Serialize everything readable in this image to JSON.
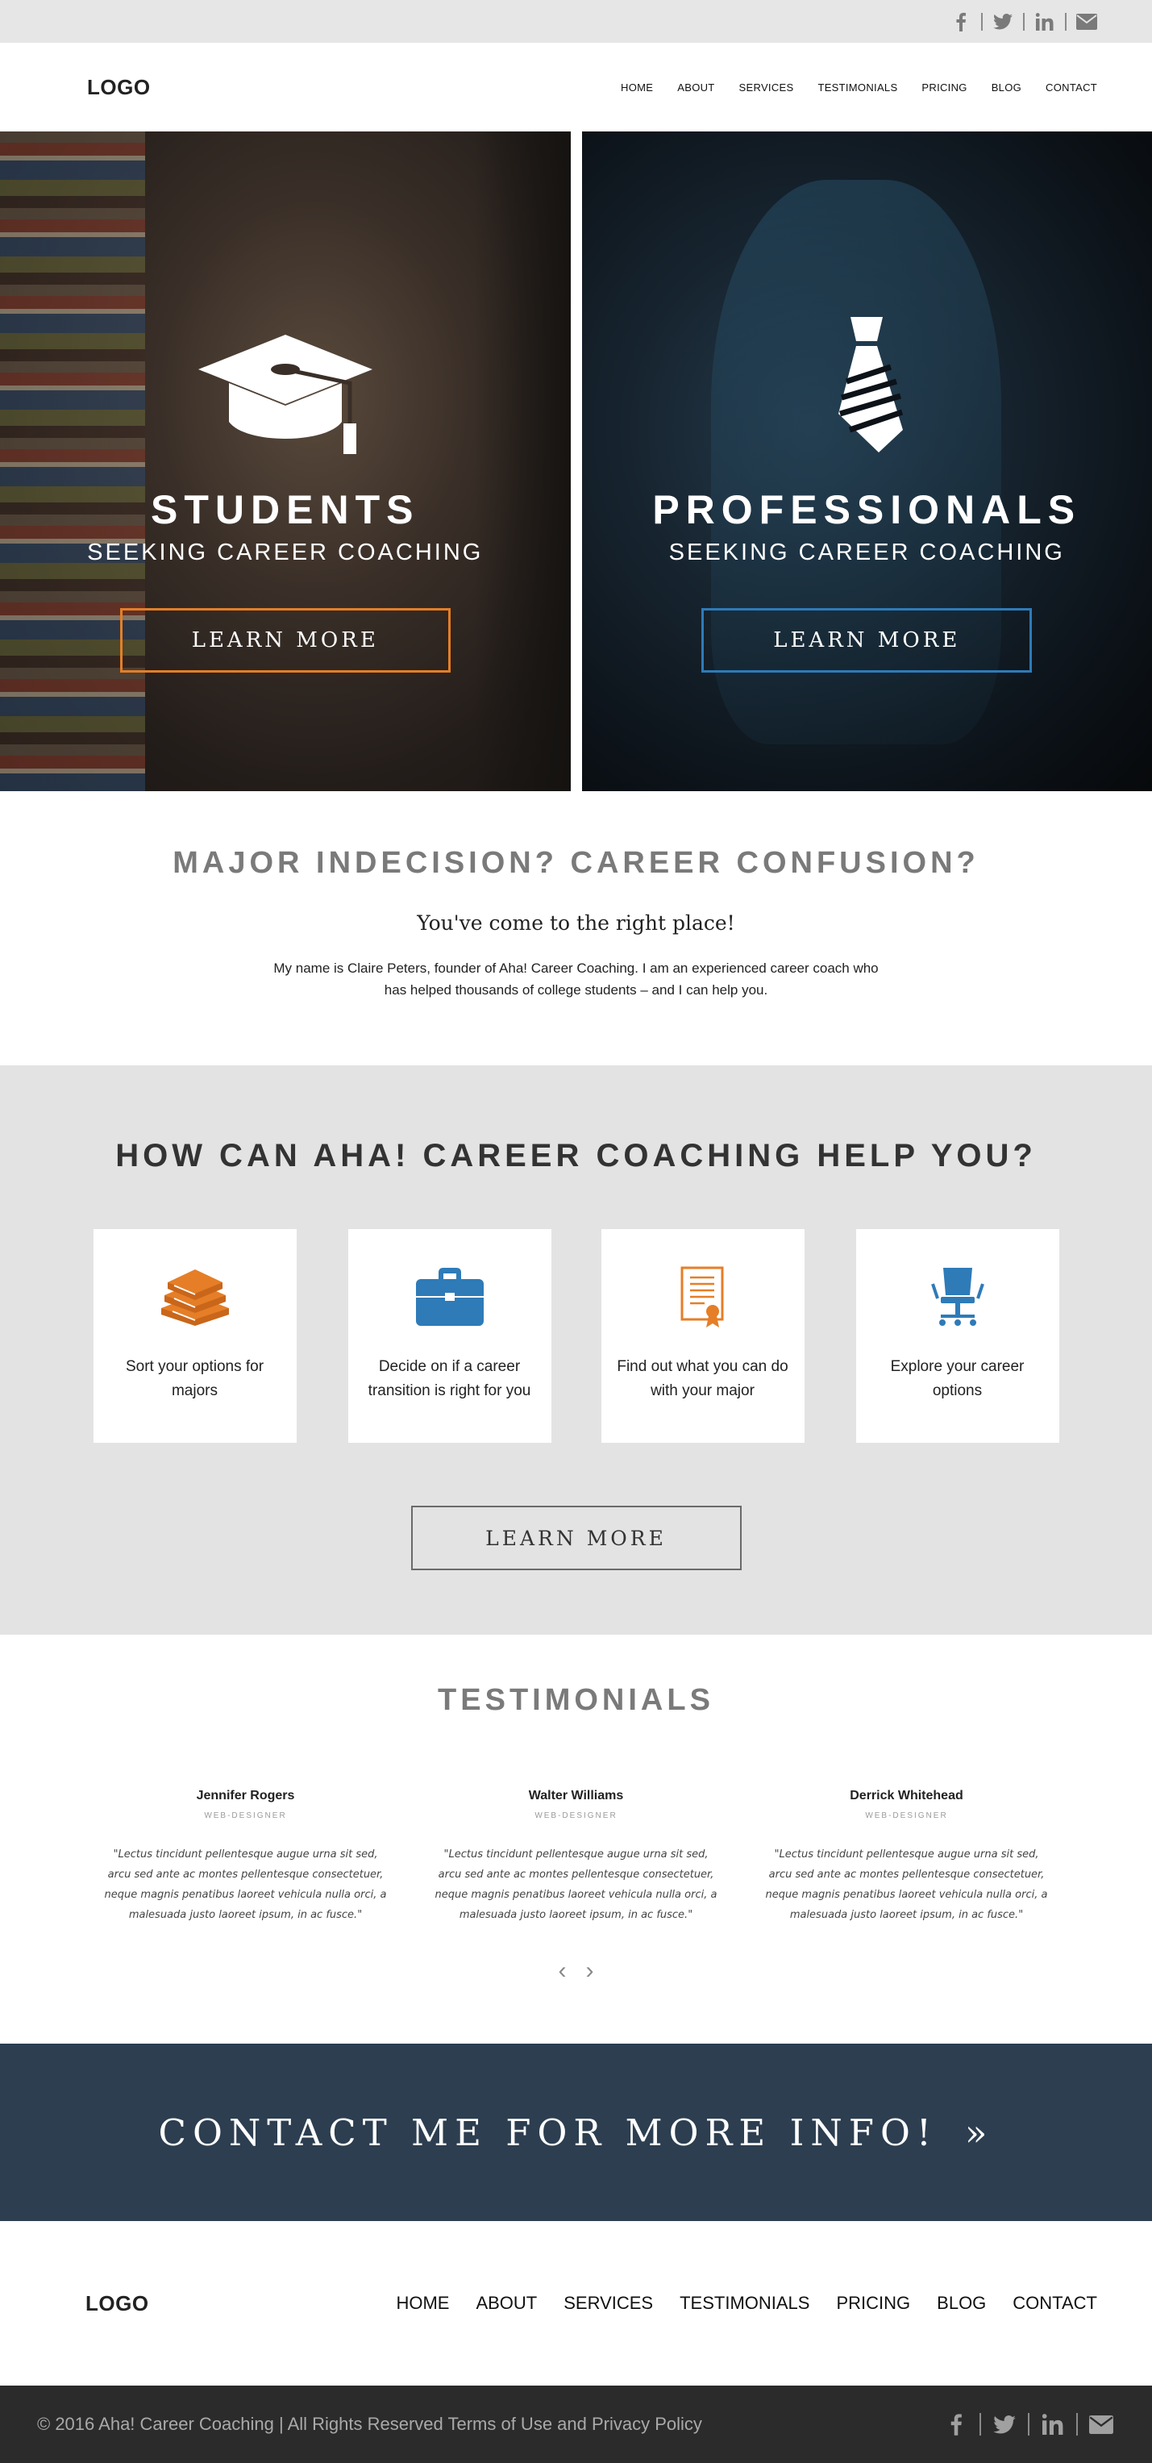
{
  "topbar": {
    "social": [
      {
        "name": "facebook-icon",
        "glyph": "f"
      },
      {
        "name": "twitter-icon",
        "glyph": "t"
      },
      {
        "name": "linkedin-icon",
        "glyph": "in"
      },
      {
        "name": "email-icon",
        "glyph": "mail"
      }
    ]
  },
  "header": {
    "logo": "LOGO",
    "nav": [
      "HOME",
      "ABOUT",
      "SERVICES",
      "TESTIMONIALS",
      "PRICING",
      "BLOG",
      "CONTACT"
    ]
  },
  "hero": {
    "students": {
      "icon": "graduation-cap-icon",
      "title": "STUDENTS",
      "subtitle": "SEEKING CAREER COACHING",
      "button": "LEARN MORE",
      "accent": "#e57e27"
    },
    "professionals": {
      "icon": "necktie-icon",
      "title": "PROFESSIONALS",
      "subtitle": "SEEKING CAREER COACHING",
      "button": "LEARN MORE",
      "accent": "#2e7bb8"
    }
  },
  "intro": {
    "heading": "MAJOR INDECISION? CAREER CONFUSION?",
    "lead": "You've come to the right place!",
    "body": "My name is Claire Peters, founder of Aha! Career Coaching. I am an experienced career coach who has helped thousands of college students – and I can help you."
  },
  "help": {
    "heading": "HOW CAN AHA! CAREER COACHING HELP YOU?",
    "cards": [
      {
        "icon": "books-icon",
        "color": "#e57e27",
        "text": "Sort your options for majors"
      },
      {
        "icon": "briefcase-icon",
        "color": "#2e7bb8",
        "text": "Decide on if a career transition is right for you"
      },
      {
        "icon": "certificate-icon",
        "color": "#e57e27",
        "text": "Find out what you can do with your major"
      },
      {
        "icon": "office-chair-icon",
        "color": "#2e7bb8",
        "text": "Explore your career options"
      }
    ],
    "button": "LEARN MORE"
  },
  "testimonials": {
    "heading": "TESTIMONIALS",
    "items": [
      {
        "name": "Jennifer Rogers",
        "role": "WEB-DESIGNER",
        "quote": "\"Lectus tincidunt pellentesque augue urna sit sed, arcu sed ante ac montes pellentesque consectetuer, neque magnis penatibus laoreet vehicula nulla orci, a malesuada justo laoreet ipsum, in ac fusce.\""
      },
      {
        "name": "Walter Williams",
        "role": "WEB-DESIGNER",
        "quote": "\"Lectus tincidunt pellentesque augue urna sit sed, arcu sed ante ac montes pellentesque consectetuer, neque magnis penatibus laoreet vehicula nulla orci, a malesuada justo laoreet ipsum, in ac fusce.\""
      },
      {
        "name": "Derrick Whitehead",
        "role": "WEB-DESIGNER",
        "quote": "\"Lectus tincidunt pellentesque augue urna sit sed, arcu sed ante ac montes pellentesque consectetuer, neque magnis penatibus laoreet vehicula nulla orci, a malesuada justo laoreet ipsum, in ac fusce.\""
      }
    ],
    "prev": "‹",
    "next": "›"
  },
  "contact": {
    "label": "CONTACT ME FOR MORE INFO!",
    "chevron": "»",
    "background": "#2c3e50"
  },
  "footer": {
    "logo": "LOGO",
    "nav": [
      "HOME",
      "ABOUT",
      "SERVICES",
      "TESTIMONIALS",
      "PRICING",
      "BLOG",
      "CONTACT"
    ]
  },
  "bottombar": {
    "copyright": "© 2016 Aha! Career Coaching  |  All Rights Reserved Terms of Use and Privacy Policy"
  }
}
